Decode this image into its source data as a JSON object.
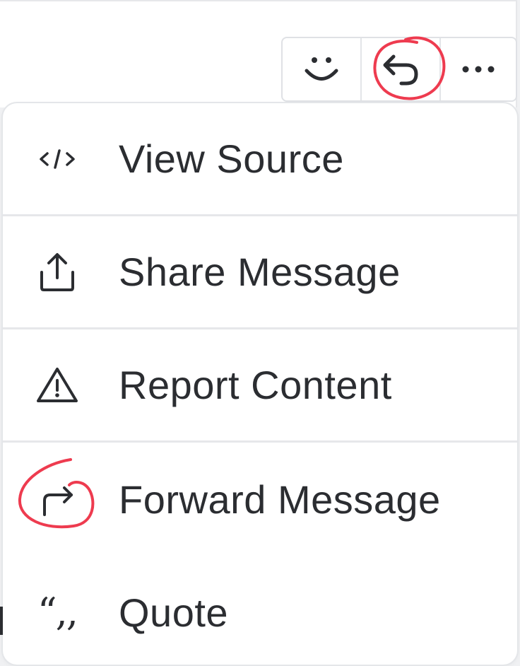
{
  "toolbar": {
    "emoji_icon": "smiley-icon",
    "reply_icon": "reply-arrow-icon",
    "more_icon": "ellipsis-icon"
  },
  "menu": {
    "items": [
      {
        "label": "View Source",
        "icon": "code-icon"
      },
      {
        "label": "Share Message",
        "icon": "share-upload-icon"
      },
      {
        "label": "Report Content",
        "icon": "warning-triangle-icon"
      },
      {
        "label": "Forward Message",
        "icon": "forward-arrow-icon"
      },
      {
        "label": "Quote",
        "icon": "quote-marks-icon",
        "glyph": "“,,"
      }
    ]
  },
  "annotations": {
    "color": "#ee3b4f",
    "circled": [
      "reply-button",
      "forward-message-icon"
    ]
  },
  "colors": {
    "text": "#2b2d31",
    "divider": "#e6e7ea",
    "annotation": "#ee3b4f"
  }
}
